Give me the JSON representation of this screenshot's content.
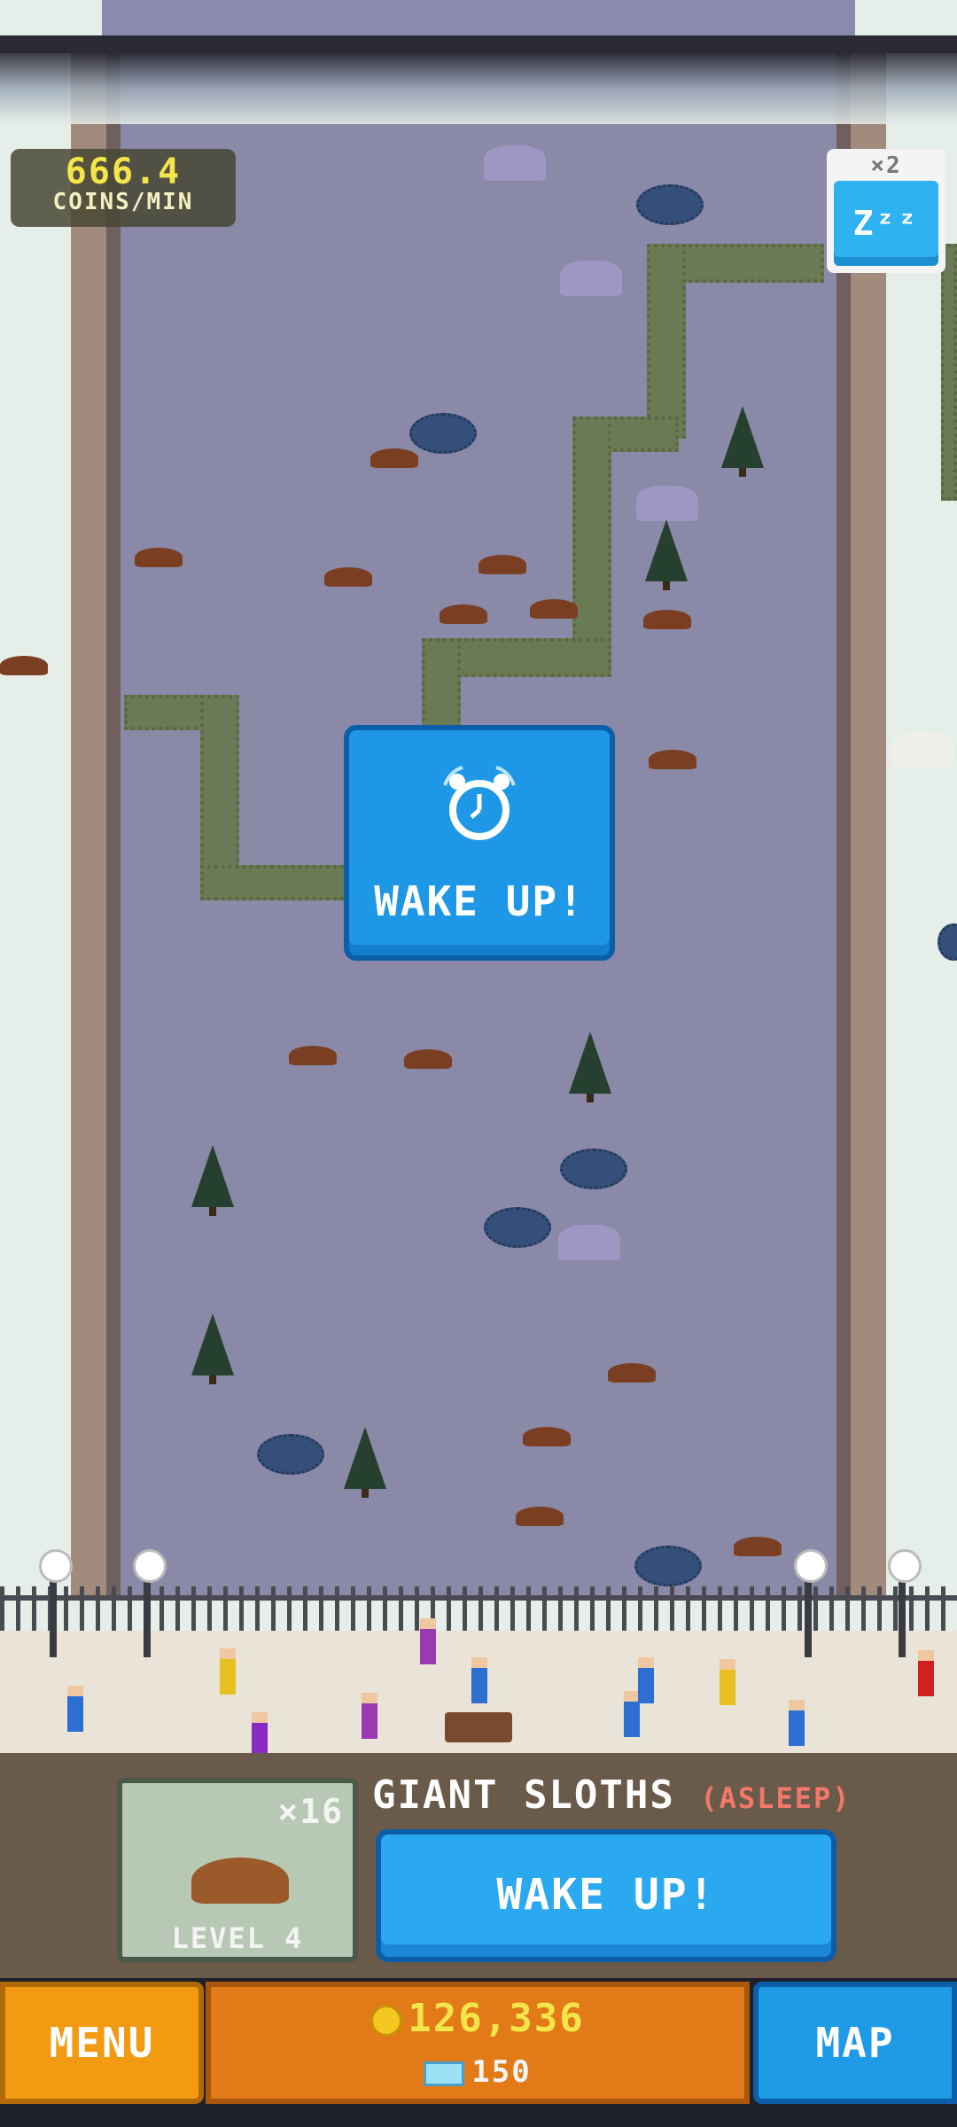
{
  "hud": {
    "coins_rate_value": "666.4",
    "coins_rate_unit": "COINS/MIN",
    "speed_multiplier": "×2",
    "sleep_label": "Zᶻᶻ"
  },
  "overlay": {
    "wake_label": "WAKE UP!",
    "icon": "alarm-clock-icon"
  },
  "animal_panel": {
    "card_count": "×16",
    "card_level": "LEVEL 4",
    "name": "GIANT SLOTHS",
    "status": "(ASLEEP)",
    "wake_button_label": "WAKE UP!"
  },
  "bottom_bar": {
    "menu_label": "MENU",
    "coins": "126,336",
    "gems": "150",
    "map_label": "MAP"
  },
  "colors": {
    "enclosure_floor": "#8b89a8",
    "button_blue": "#1e98e6",
    "menu_orange": "#f29a12",
    "coin_yellow": "#f4e64a",
    "status_red": "#f1786a"
  }
}
